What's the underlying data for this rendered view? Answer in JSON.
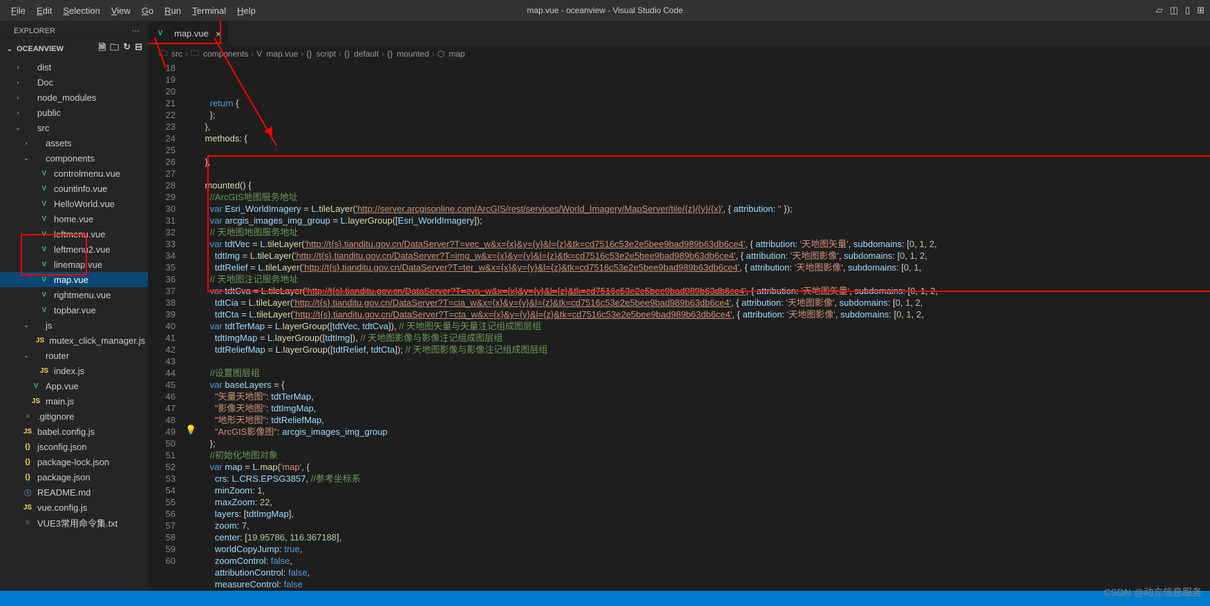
{
  "menubar": {
    "items": [
      "File",
      "Edit",
      "Selection",
      "View",
      "Go",
      "Run",
      "Terminal",
      "Help"
    ],
    "title": "map.vue - oceanview - Visual Studio Code"
  },
  "explorer": {
    "header": "EXPLORER",
    "project": "OCEANVIEW",
    "tree": [
      {
        "d": 1,
        "t": "folder",
        "n": "dist",
        "e": false
      },
      {
        "d": 1,
        "t": "folder",
        "n": "Doc",
        "e": false
      },
      {
        "d": 1,
        "t": "folder",
        "n": "node_modules",
        "e": false
      },
      {
        "d": 1,
        "t": "folder",
        "n": "public",
        "e": false
      },
      {
        "d": 1,
        "t": "folder",
        "n": "src",
        "e": true
      },
      {
        "d": 2,
        "t": "folder",
        "n": "assets",
        "e": false
      },
      {
        "d": 2,
        "t": "folder",
        "n": "components",
        "e": true
      },
      {
        "d": 3,
        "t": "vue",
        "n": "controlmenu.vue"
      },
      {
        "d": 3,
        "t": "vue",
        "n": "countinfo.vue"
      },
      {
        "d": 3,
        "t": "vue",
        "n": "HelloWorld.vue"
      },
      {
        "d": 3,
        "t": "vue",
        "n": "home.vue"
      },
      {
        "d": 3,
        "t": "vue",
        "n": "leftmenu.vue"
      },
      {
        "d": 3,
        "t": "vue",
        "n": "leftmenu2.vue"
      },
      {
        "d": 3,
        "t": "vue",
        "n": "linemap.vue"
      },
      {
        "d": 3,
        "t": "vue",
        "n": "map.vue",
        "sel": true
      },
      {
        "d": 3,
        "t": "vue",
        "n": "rightmenu.vue"
      },
      {
        "d": 3,
        "t": "vue",
        "n": "topbar.vue"
      },
      {
        "d": 2,
        "t": "folder",
        "n": "js",
        "e": true
      },
      {
        "d": 3,
        "t": "js",
        "n": "mutex_click_manager.js"
      },
      {
        "d": 2,
        "t": "folder",
        "n": "router",
        "e": true
      },
      {
        "d": 3,
        "t": "js",
        "n": "index.js"
      },
      {
        "d": 2,
        "t": "vue",
        "n": "App.vue"
      },
      {
        "d": 2,
        "t": "js",
        "n": "main.js"
      },
      {
        "d": 1,
        "t": "txt",
        "n": ".gitignore"
      },
      {
        "d": 1,
        "t": "js",
        "n": "babel.config.js"
      },
      {
        "d": 1,
        "t": "json",
        "n": "jsconfig.json"
      },
      {
        "d": 1,
        "t": "json",
        "n": "package-lock.json"
      },
      {
        "d": 1,
        "t": "json",
        "n": "package.json"
      },
      {
        "d": 1,
        "t": "md",
        "n": "README.md"
      },
      {
        "d": 1,
        "t": "js",
        "n": "vue.config.js"
      },
      {
        "d": 1,
        "t": "txt",
        "n": "VUE3常用命令集.txt"
      }
    ]
  },
  "tab": {
    "label": "map.vue"
  },
  "breadcrumb": [
    "src",
    "components",
    "map.vue",
    "script",
    "default",
    "mounted",
    "map"
  ],
  "lineNumbers": [
    18,
    19,
    20,
    21,
    22,
    23,
    24,
    25,
    26,
    27,
    28,
    29,
    30,
    31,
    32,
    33,
    34,
    35,
    36,
    37,
    38,
    39,
    40,
    41,
    42,
    43,
    44,
    45,
    46,
    47,
    48,
    49,
    50,
    51,
    52,
    53,
    54,
    55,
    56,
    57,
    58,
    59,
    60
  ],
  "code": [
    {
      "i": 3,
      "h": "<span class='s-kw'>return</span> {"
    },
    {
      "i": 3,
      "h": "};"
    },
    {
      "i": 2,
      "h": "},"
    },
    {
      "i": 2,
      "h": "<span class='s-fn'>methods</span>: {"
    },
    {
      "i": 2,
      "h": ""
    },
    {
      "i": 2,
      "h": "},"
    },
    {
      "i": 2,
      "h": ""
    },
    {
      "i": 2,
      "h": "<span class='s-fn'>mounted</span>() {"
    },
    {
      "i": 3,
      "h": "<span class='s-com'>//ArcGIS地图服务地址</span>"
    },
    {
      "i": 3,
      "h": "<span class='s-kw'>var</span> <span class='s-var'>Esri_WorldImagery</span> = <span class='s-var'>L</span>.<span class='s-fn'>tileLayer</span>(<span class='s-link'>'http://server.arcgisonline.com/ArcGIS/rest/services/World_Imagery/MapServer/tile/{z}/{y}/{x}'</span>, { <span class='s-prop'>attribution</span>: <span class='s-str'>''</span> });"
    },
    {
      "i": 3,
      "h": "<span class='s-kw'>var</span> <span class='s-var'>arcgis_images_img_group</span> = <span class='s-var'>L</span>.<span class='s-fn'>layerGroup</span>([<span class='s-var'>Esri_WorldImagery</span>]);"
    },
    {
      "i": 3,
      "h": "<span class='s-com'>// 天地图地图服务地址</span>"
    },
    {
      "i": 3,
      "h": "<span class='s-kw'>var</span> <span class='s-var'>tdtVec</span> = <span class='s-var'>L</span>.<span class='s-fn'>tileLayer</span>(<span class='s-link'>'http://t{s}.tianditu.gov.cn/DataServer?T=vec_w&x={x}&y={y}&l={z}&tk=cd7516c53e2e5bee9bad989b63db6ce4'</span>, { <span class='s-prop'>attribution</span>: <span class='s-str'>'天地图矢量'</span>, <span class='s-prop'>subdomains</span>: [<span class='s-num'>0</span>, <span class='s-num'>1</span>, <span class='s-num'>2</span>,"
    },
    {
      "i": 4,
      "h": "<span class='s-var'>tdtImg</span> = <span class='s-var'>L</span>.<span class='s-fn'>tileLayer</span>(<span class='s-link'>'http://t{s}.tianditu.gov.cn/DataServer?T=img_w&x={x}&y={y}&l={z}&tk=cd7516c53e2e5bee9bad989b63db6ce4'</span>, { <span class='s-prop'>attribution</span>: <span class='s-str'>'天地图影像'</span>, <span class='s-prop'>subdomains</span>: [<span class='s-num'>0</span>, <span class='s-num'>1</span>, <span class='s-num'>2</span>,"
    },
    {
      "i": 4,
      "h": "<span class='s-var'>tdtRelief</span> = <span class='s-var'>L</span>.<span class='s-fn'>tileLayer</span>(<span class='s-link'>'http://t{s}.tianditu.gov.cn/DataServer?T=ter_w&x={x}&y={y}&l={z}&tk=cd7516c53e2e5bee9bad989b63db6ce4'</span>, { <span class='s-prop'>attribution</span>: <span class='s-str'>'天地图影像'</span>, <span class='s-prop'>subdomains</span>: [<span class='s-num'>0</span>, <span class='s-num'>1</span>,"
    },
    {
      "i": 3,
      "h": "<span class='s-com'>// 天地图注记服务地址</span>"
    },
    {
      "i": 3,
      "h": "<span class='s-kw'>var</span> <span class='s-var'>tdtCva</span> = <span class='s-var'>L</span>.<span class='s-fn'>tileLayer</span>(<span class='s-link'>'http://t{s}.tianditu.gov.cn/DataServer?T=cva_w&x={x}&y={y}&l={z}&tk=cd7516c53e2e5bee9bad989b63db6ce4'</span>, { <span class='s-prop'>attribution</span>: <span class='s-str'>'天地图矢量'</span>, <span class='s-prop'>subdomains</span>: [<span class='s-num'>0</span>, <span class='s-num'>1</span>, <span class='s-num'>2</span>,"
    },
    {
      "i": 4,
      "h": "<span class='s-var'>tdtCia</span> = <span class='s-var'>L</span>.<span class='s-fn'>tileLayer</span>(<span class='s-link'>'http://t{s}.tianditu.gov.cn/DataServer?T=cia_w&x={x}&y={y}&l={z}&tk=cd7516c53e2e5bee9bad989b63db6ce4'</span>, { <span class='s-prop'>attribution</span>: <span class='s-str'>'天地图影像'</span>, <span class='s-prop'>subdomains</span>: [<span class='s-num'>0</span>, <span class='s-num'>1</span>, <span class='s-num'>2</span>,"
    },
    {
      "i": 4,
      "h": "<span class='s-var'>tdtCta</span> = <span class='s-var'>L</span>.<span class='s-fn'>tileLayer</span>(<span class='s-link'>'http://t{s}.tianditu.gov.cn/DataServer?T=cta_w&x={x}&y={y}&l={z}&tk=cd7516c53e2e5bee9bad989b63db6ce4'</span>, { <span class='s-prop'>attribution</span>: <span class='s-str'>'天地图影像'</span>, <span class='s-prop'>subdomains</span>: [<span class='s-num'>0</span>, <span class='s-num'>1</span>, <span class='s-num'>2</span>,"
    },
    {
      "i": 3,
      "h": "<span class='s-kw'>var</span> <span class='s-var'>tdtTerMap</span> = <span class='s-var'>L</span>.<span class='s-fn'>layerGroup</span>([<span class='s-var'>tdtVec</span>, <span class='s-var'>tdtCva</span>]), <span class='s-com'>// 天地图矢量与矢量注记组成图层组</span>"
    },
    {
      "i": 4,
      "h": "<span class='s-var'>tdtImgMap</span> = <span class='s-var'>L</span>.<span class='s-fn'>layerGroup</span>([<span class='s-var'>tdtImg</span>]), <span class='s-com'>// 天地图影像与影像注记组成图层组</span>"
    },
    {
      "i": 4,
      "h": "<span class='s-var'>tdtReliefMap</span> = <span class='s-var'>L</span>.<span class='s-fn'>layerGroup</span>([<span class='s-var'>tdtRelief</span>, <span class='s-var'>tdtCta</span>]); <span class='s-com'>// 天地图影像与影像注记组成图层组</span>"
    },
    {
      "i": 3,
      "h": ""
    },
    {
      "i": 3,
      "h": "<span class='s-com'>//设置图层组</span>"
    },
    {
      "i": 3,
      "h": "<span class='s-kw'>var</span> <span class='s-var'>baseLayers</span> = {"
    },
    {
      "i": 4,
      "h": "<span class='s-str'>\"矢量天地图\"</span>: <span class='s-var'>tdtTerMap</span>,"
    },
    {
      "i": 4,
      "h": "<span class='s-str'>\"影像天地图\"</span>: <span class='s-var'>tdtImgMap</span>,"
    },
    {
      "i": 4,
      "h": "<span class='s-str'>\"地形天地图\"</span>: <span class='s-var'>tdtReliefMap</span>,"
    },
    {
      "i": 4,
      "h": "<span class='s-str'>\"ArcGIS影像图\"</span>: <span class='s-var'>arcgis_images_img_group</span>"
    },
    {
      "i": 3,
      "h": "};"
    },
    {
      "i": 3,
      "h": "<span class='s-com'>//初始化地图对象</span>"
    },
    {
      "i": 3,
      "h": "<span class='s-kw'>var</span> <span class='s-var'>map</span> = <span class='s-var'>L</span>.<span class='s-fn'>map</span>(<span class='s-str'>'map'</span>, {"
    },
    {
      "i": 4,
      "h": "<span class='s-prop'>crs</span>: <span class='s-var'>L</span>.<span class='s-var'>CRS</span>.<span class='s-var'>EPSG3857</span>, <span class='s-com'>//参考坐标系</span>"
    },
    {
      "i": 4,
      "h": "<span class='s-prop'>minZoom</span>: <span class='s-num'>1</span>,"
    },
    {
      "i": 4,
      "h": "<span class='s-prop'>maxZoom</span>: <span class='s-num'>22</span>,"
    },
    {
      "i": 4,
      "h": "<span class='s-prop'>layers</span>: [<span class='s-var'>tdtImgMap</span>],"
    },
    {
      "i": 4,
      "h": "<span class='s-prop'>zoom</span>: <span class='s-num'>7</span>,"
    },
    {
      "i": 4,
      "h": "<span class='s-prop'>center</span>: [<span class='s-num'>19.95786</span>, <span class='s-num'>116.367188</span>],"
    },
    {
      "i": 4,
      "h": "<span class='s-prop'>worldCopyJump</span>: <span class='s-const'>true</span>,"
    },
    {
      "i": 4,
      "h": "<span class='s-prop'>zoomControl</span>: <span class='s-const'>false</span>,"
    },
    {
      "i": 4,
      "h": "<span class='s-prop'>attributionControl</span>: <span class='s-const'>false</span>,"
    },
    {
      "i": 4,
      "h": "<span class='s-prop'>measureControl</span>: <span class='s-const'>false</span>"
    },
    {
      "i": 3,
      "h": "});"
    }
  ],
  "watermark": "CSDN @动立信息服务"
}
